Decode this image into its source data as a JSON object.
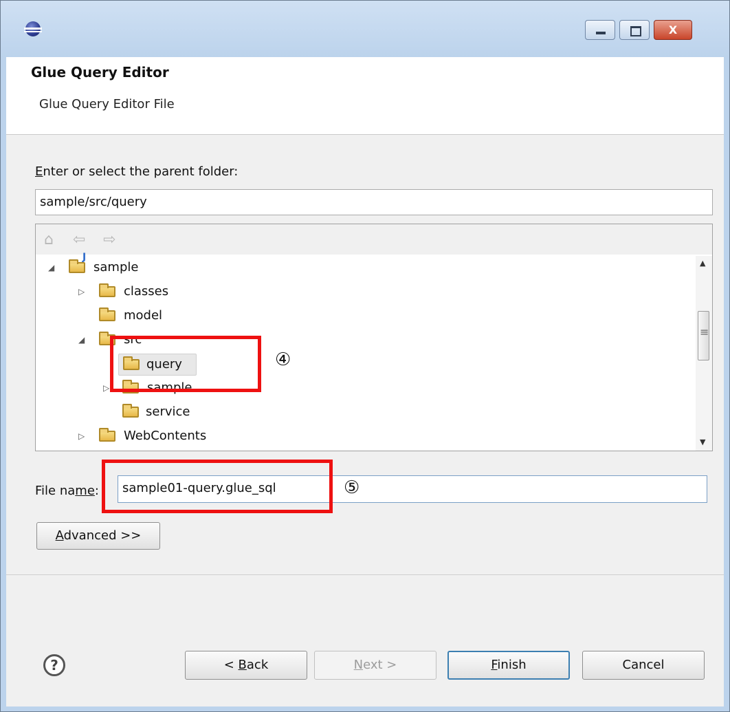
{
  "window": {
    "title": "",
    "close_glyph": "X",
    "accent": "#3c7fb1",
    "annotation_color": "#ee1111"
  },
  "header": {
    "title": "Glue Query Editor",
    "subtitle": "Glue Query Editor File"
  },
  "parent_folder": {
    "label_prefix": "E",
    "label_rest": "nter or select the parent folder:",
    "value": "sample/src/query"
  },
  "tree_toolbar": {
    "home_icon": "home-icon",
    "back_icon": "back-arrow-icon",
    "forward_icon": "forward-arrow-icon"
  },
  "tree": [
    {
      "label": "sample",
      "expanded": true
    },
    {
      "label": "classes",
      "expanded": false
    },
    {
      "label": "model"
    },
    {
      "label": "src",
      "expanded": true
    },
    {
      "label": "query",
      "selected": true
    },
    {
      "label": "sample",
      "expanded": false
    },
    {
      "label": "service"
    },
    {
      "label": "WebContents",
      "expanded": false
    }
  ],
  "file_name": {
    "label_a": "File na",
    "label_mn": "me",
    "label_b": ":",
    "value": "sample01-query.glue_sql"
  },
  "advanced": {
    "prefix": "A",
    "rest": "dvanced >>"
  },
  "annotations": {
    "four": "④",
    "five": "⑤"
  },
  "buttons": {
    "help": "?",
    "back_a": "< ",
    "back_u": "B",
    "back_b": "ack",
    "next_u": "N",
    "next_b": "ext >",
    "finish_u": "F",
    "finish_b": "inish",
    "cancel": "Cancel"
  }
}
